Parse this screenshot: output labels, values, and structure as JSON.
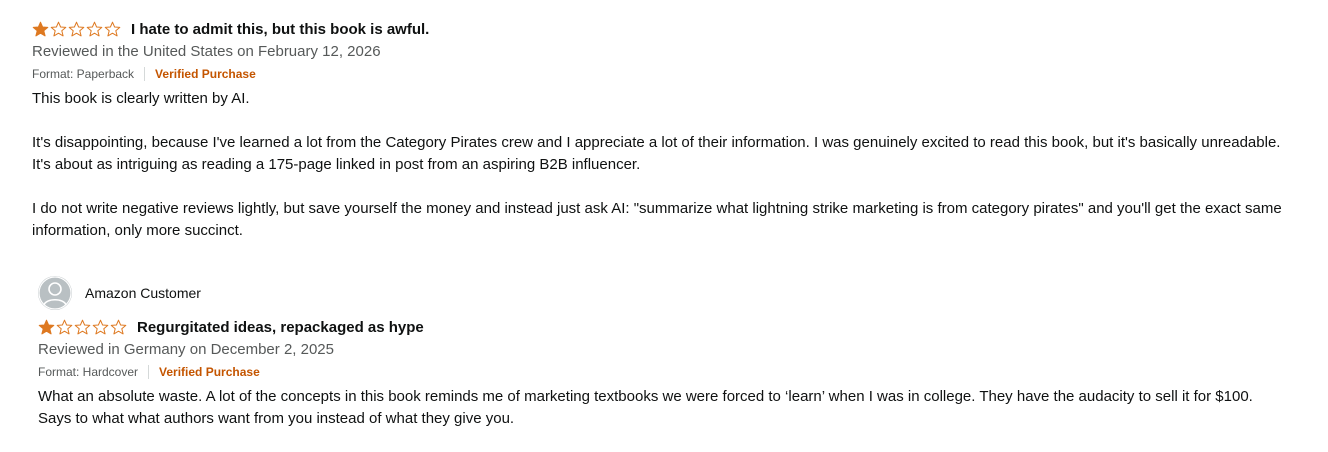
{
  "reviews": [
    {
      "reviewer": "",
      "rating": 1,
      "max_rating": 5,
      "title": "I hate to admit this, but this book is awful.",
      "reviewed_in": "Reviewed in the United States on February 12, 2026",
      "format": "Format: Paperback",
      "verified": "Verified Purchase",
      "body": [
        "This book is clearly written by AI.",
        "It's disappointing, because I've learned a lot from the Category Pirates crew and I appreciate a lot of their information. I was genuinely excited to read this book, but it's basically unreadable. It's about as intriguing as reading a 175-page linked in post from an aspiring B2B influencer.",
        "I do not write negative reviews lightly, but save yourself the money and instead just ask AI: \"summarize what lightning strike marketing is from category pirates\" and you'll get the exact same information, only more succinct."
      ]
    },
    {
      "reviewer": "Amazon Customer",
      "rating": 1,
      "max_rating": 5,
      "title": "Regurgitated ideas, repackaged as hype",
      "reviewed_in": "Reviewed in Germany on December 2, 2025",
      "format": "Format: Hardcover",
      "verified": "Verified Purchase",
      "body": [
        "What an absolute waste. A lot of the concepts in this book reminds me of marketing textbooks we were forced to ‘learn’ when I was in college. They have the audacity to sell it for $100. Says to what what authors want from you instead of what they give you."
      ]
    }
  ],
  "colors": {
    "star_filled": "#f3a847",
    "star_outline": "#de7921",
    "verified": "#c45500",
    "meta": "#565959",
    "avatar": "#b9c0c3"
  },
  "icons": {
    "avatar": "person-silhouette-icon",
    "star": "star-icon"
  }
}
